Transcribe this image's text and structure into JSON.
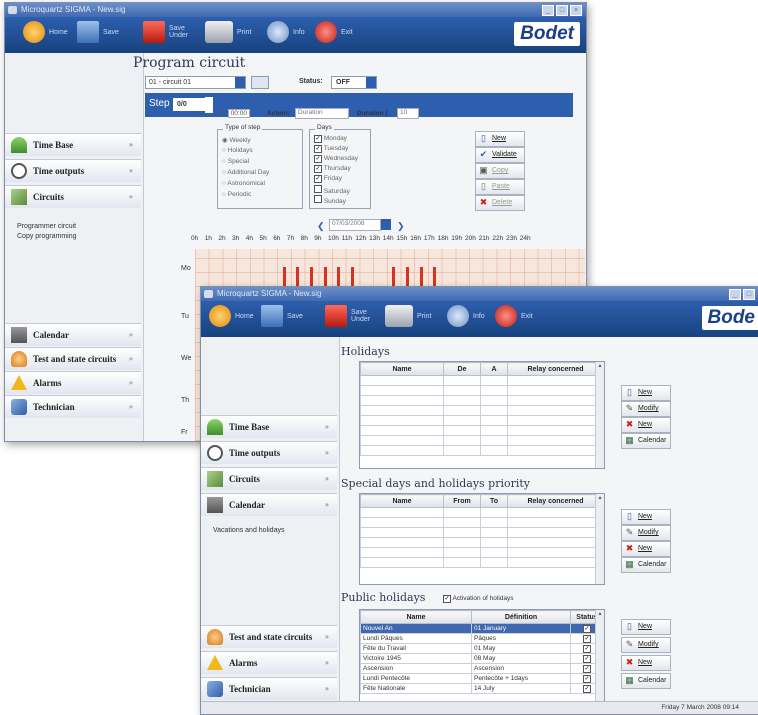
{
  "back": {
    "title": "Microquartz SIGMA - New.sig",
    "toolbar": [
      {
        "label": "Home",
        "icon": "home-icon"
      },
      {
        "label": "Save",
        "icon": "save-icon"
      },
      {
        "label": "Save\nUnder",
        "icon": "save-under-icon"
      },
      {
        "label": "Print",
        "icon": "print-icon"
      },
      {
        "label": "Info",
        "icon": "info-icon"
      },
      {
        "label": "Exit",
        "icon": "exit-icon"
      }
    ],
    "logo": "Bodet",
    "page_title": "Program circuit",
    "circuit_select": "01 - circuit 01",
    "status_label": "Status:",
    "status_value": "OFF",
    "step_label": "Step",
    "step_value": "0/0",
    "to_label": "To",
    "to_value": "00:00",
    "action_label": "Action:",
    "action_value": "Duration",
    "duration_label": "Duration (",
    "duration_value": "10",
    "type_group": "Type of step",
    "types": [
      "Weekly",
      "Holidays",
      "Special",
      "Additional Day",
      "Astronomical",
      "Periodic"
    ],
    "days_group": "Days",
    "days": [
      "Monday",
      "Tuesday",
      "Wednesday",
      "Thursday",
      "Friday",
      "Saturday",
      "Sunday"
    ],
    "days_checked": [
      true,
      true,
      true,
      true,
      true,
      false,
      false
    ],
    "buttons": [
      "New",
      "Validate",
      "Copy",
      "Paste",
      "Delete"
    ],
    "date": "07/03/2008",
    "hours": [
      "0h",
      "1h",
      "2h",
      "3h",
      "4h",
      "5h",
      "6h",
      "7h",
      "8h",
      "9h",
      "10h",
      "11h",
      "12h",
      "13h",
      "14h",
      "15h",
      "16h",
      "17h",
      "18h",
      "19h",
      "20h",
      "21h",
      "22h",
      "23h",
      "24h"
    ],
    "day_rows": [
      "Mo",
      "Tu",
      "We",
      "Th",
      "Fr"
    ],
    "nav": [
      {
        "label": "Time Base",
        "icon": "antenna-icon"
      },
      {
        "label": "Time outputs",
        "icon": "clock-icon"
      },
      {
        "label": "Circuits",
        "icon": "circuits-icon"
      },
      {
        "label": "Calendar",
        "icon": "calendar-icon"
      },
      {
        "label": "Test and state circuits",
        "icon": "bell-icon"
      },
      {
        "label": "Alarms",
        "icon": "warning-icon"
      },
      {
        "label": "Technician",
        "icon": "tools-icon"
      }
    ],
    "subitems": [
      "Programmer circuit",
      "Copy programming"
    ],
    "accent": "#2d5fae",
    "bar_color": "#d9321f"
  },
  "front": {
    "title": "Microquartz SIGMA - New.sig",
    "toolbar": [
      {
        "label": "Home",
        "icon": "home-icon"
      },
      {
        "label": "Save",
        "icon": "save-icon"
      },
      {
        "label": "Save\nUnder",
        "icon": "save-under-icon"
      },
      {
        "label": "Print",
        "icon": "print-icon"
      },
      {
        "label": "Info",
        "icon": "info-icon"
      },
      {
        "label": "Exit",
        "icon": "exit-icon"
      }
    ],
    "logo": "Bode",
    "holidays": {
      "title": "Holidays",
      "columns": [
        "Name",
        "De",
        "A",
        "Relay concerned"
      ],
      "buttons": [
        "New",
        "Modify",
        "New",
        "Calendar"
      ]
    },
    "special": {
      "title": "Special days and holidays priority",
      "columns": [
        "Name",
        "From",
        "To",
        "Relay concerned"
      ],
      "buttons": [
        "New",
        "Modify",
        "New",
        "Calendar"
      ]
    },
    "public": {
      "title": "Public holidays",
      "activation_label": "Activation of holidays",
      "columns": [
        "Name",
        "Définition",
        "Status"
      ],
      "rows": [
        [
          "Nouvel An",
          "01 January"
        ],
        [
          "Lundi Pâques",
          "Pâques"
        ],
        [
          "Fête du Travail",
          "01 May"
        ],
        [
          "Victoire 1945",
          "08 May"
        ],
        [
          "Ascension",
          "Ascension"
        ],
        [
          "Lundi Pentecôte",
          "Pentecôte + 1days"
        ],
        [
          "Fête Nationale",
          "14 July"
        ]
      ],
      "buttons": [
        "New",
        "Modify",
        "New",
        "Calendar"
      ]
    },
    "nav": [
      {
        "label": "Time Base",
        "icon": "antenna-icon"
      },
      {
        "label": "Time outputs",
        "icon": "clock-icon"
      },
      {
        "label": "Circuits",
        "icon": "circuits-icon"
      },
      {
        "label": "Calendar",
        "icon": "calendar-icon"
      },
      {
        "label": "Test and state circuits",
        "icon": "bell-icon"
      },
      {
        "label": "Alarms",
        "icon": "warning-icon"
      },
      {
        "label": "Technician",
        "icon": "tools-icon"
      }
    ],
    "subitems": [
      "Vacations and holidays"
    ],
    "statusbar": "Friday 7 March 2008   09:14"
  }
}
